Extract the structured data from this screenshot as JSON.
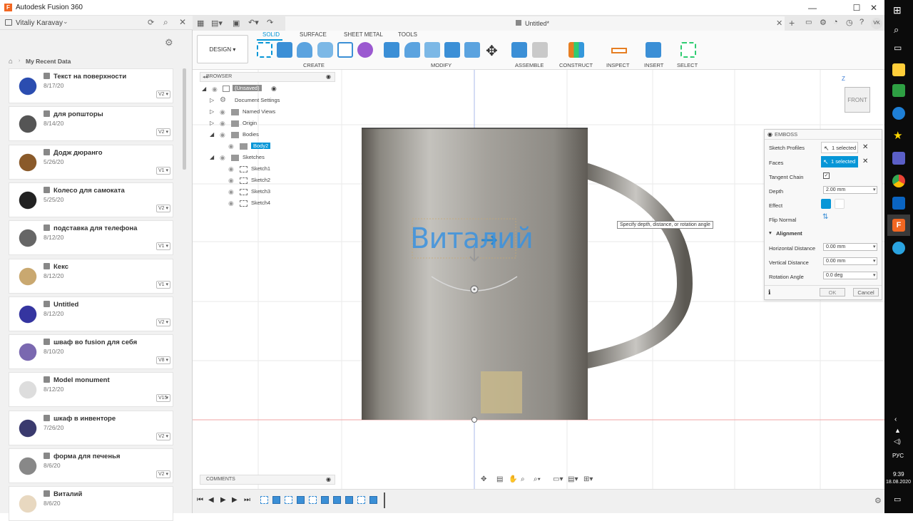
{
  "app": {
    "title": "Autodesk Fusion 360",
    "logo_letter": "F",
    "window_buttons": [
      "—",
      "☐",
      "✕"
    ]
  },
  "left_panel": {
    "user": "Vitaliy Karavay",
    "section_title": "My Recent Data",
    "items": [
      {
        "name": "Текст на поверхности",
        "date": "8/17/20",
        "version": "V2"
      },
      {
        "name": "для ропшторы",
        "date": "8/14/20",
        "version": "V2"
      },
      {
        "name": "Додж дюранго",
        "date": "5/26/20",
        "version": "V1"
      },
      {
        "name": "Колесо для самоката",
        "date": "5/25/20",
        "version": "V2"
      },
      {
        "name": "подставка для телефона",
        "date": "8/12/20",
        "version": "V1"
      },
      {
        "name": "Кекс",
        "date": "8/12/20",
        "version": "V1"
      },
      {
        "name": "Untitled",
        "date": "8/12/20",
        "version": "V2"
      },
      {
        "name": "шваф во fusion для себя",
        "date": "8/10/20",
        "version": "V8"
      },
      {
        "name": "Model monument",
        "date": "8/12/20",
        "version": "V15"
      },
      {
        "name": "шкаф в инвенторе",
        "date": "7/26/20",
        "version": "V2"
      },
      {
        "name": "форма для печенья",
        "date": "8/6/20",
        "version": "V2"
      },
      {
        "name": "Виталий",
        "date": "8/6/20",
        "version": ""
      }
    ]
  },
  "document": {
    "tab_title": "Untitled*",
    "user_initials": "VK"
  },
  "ribbon": {
    "workspace": "DESIGN",
    "tabs": [
      "SOLID",
      "SURFACE",
      "SHEET METAL",
      "TOOLS"
    ],
    "active_tab": "SOLID",
    "groups": [
      "CREATE",
      "MODIFY",
      "ASSEMBLE",
      "CONSTRUCT",
      "INSPECT",
      "INSERT",
      "SELECT"
    ]
  },
  "browser": {
    "title": "BROWSER",
    "root": "(Unsaved)",
    "rows": [
      {
        "label": "Document Settings",
        "indent": 1
      },
      {
        "label": "Named Views",
        "indent": 1
      },
      {
        "label": "Origin",
        "indent": 1
      },
      {
        "label": "Bodies",
        "indent": 1
      },
      {
        "label": "Body2",
        "indent": 2,
        "selected": true
      },
      {
        "label": "Sketches",
        "indent": 1
      },
      {
        "label": "Sketch1",
        "indent": 2
      },
      {
        "label": "Sketch2",
        "indent": 2
      },
      {
        "label": "Sketch3",
        "indent": 2
      },
      {
        "label": "Sketch4",
        "indent": 2
      }
    ]
  },
  "comments": {
    "title": "COMMENTS"
  },
  "viewport": {
    "emboss_text": "Виталий",
    "viewcube": "FRONT",
    "tooltip": "Specify depth, distance, or rotation angle"
  },
  "emboss": {
    "title": "EMBOSS",
    "sketch_profiles": {
      "label": "Sketch Profiles",
      "value": "1 selected"
    },
    "faces": {
      "label": "Faces",
      "value": "1 selected"
    },
    "tangent_chain": {
      "label": "Tangent Chain",
      "checked": true
    },
    "depth": {
      "label": "Depth",
      "value": "2.00 mm"
    },
    "effect": {
      "label": "Effect"
    },
    "flip_normal": {
      "label": "Flip Normal"
    },
    "alignment": {
      "title": "Alignment"
    },
    "horizontal_distance": {
      "label": "Horizontal Distance",
      "value": "0.00 mm"
    },
    "vertical_distance": {
      "label": "Vertical Distance",
      "value": "0.00 mm"
    },
    "rotation_angle": {
      "label": "Rotation Angle",
      "value": "0.0 deg"
    },
    "ok": "OK",
    "cancel": "Cancel"
  },
  "taskbar": {
    "lang": "РУС",
    "time": "9:39",
    "date": "18.08.2020"
  },
  "colors": {
    "accent": "#0696d7",
    "fusion_orange": "#f26722",
    "mug": "#8a8780"
  }
}
